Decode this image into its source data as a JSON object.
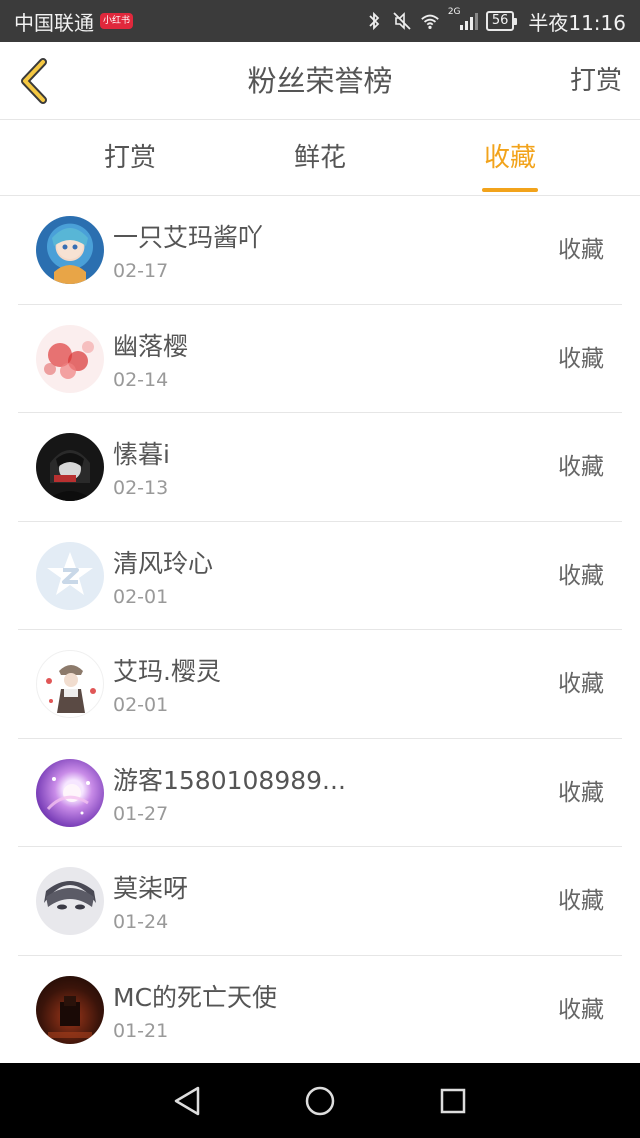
{
  "status_bar": {
    "carrier": "中国联通",
    "carrier_badge": "小红书",
    "network": "2G",
    "battery": "56",
    "time": "半夜11:16"
  },
  "header": {
    "title": "粉丝荣誉榜",
    "action": "打赏",
    "accent_color": "#f2a31b"
  },
  "tabs": [
    {
      "label": "打赏",
      "active": false
    },
    {
      "label": "鲜花",
      "active": false
    },
    {
      "label": "收藏",
      "active": true
    }
  ],
  "list": [
    {
      "name": "一只艾玛酱吖",
      "date": "02-17",
      "action": "收藏",
      "avatar": "anime-girl-avatar"
    },
    {
      "name": "幽落樱",
      "date": "02-14",
      "action": "收藏",
      "avatar": "red-flower-avatar"
    },
    {
      "name": "愫暮i",
      "date": "02-13",
      "action": "收藏",
      "avatar": "dark-anime-avatar"
    },
    {
      "name": "清风玲心",
      "date": "02-01",
      "action": "收藏",
      "avatar": "default-star-avatar"
    },
    {
      "name": "艾玛.樱灵",
      "date": "02-01",
      "action": "收藏",
      "avatar": "anime-character-avatar"
    },
    {
      "name": "游客1580108989...",
      "date": "01-27",
      "action": "收藏",
      "avatar": "purple-sparkle-avatar"
    },
    {
      "name": "莫柒呀",
      "date": "01-24",
      "action": "收藏",
      "avatar": "anime-boy-avatar"
    },
    {
      "name": "MC的死亡天使",
      "date": "01-21",
      "action": "收藏",
      "avatar": "dark-red-avatar"
    }
  ],
  "navbar": {
    "buttons": [
      "back-triangle-icon",
      "home-circle-icon",
      "recents-square-icon"
    ]
  }
}
